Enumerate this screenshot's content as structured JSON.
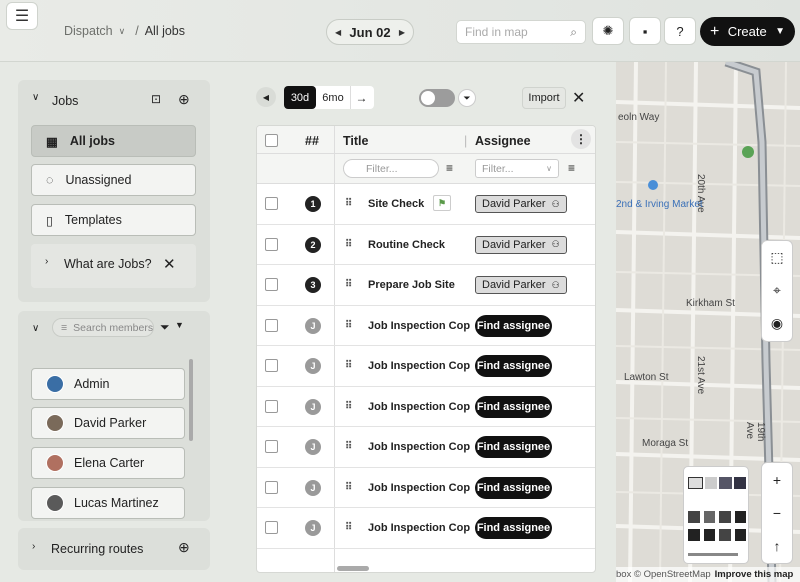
{
  "topbar": {
    "breadcrumb_parent": "Dispatch",
    "breadcrumb_current": "All jobs",
    "date": "Jun 02",
    "map_search_placeholder": "Find in map",
    "help_label": "?",
    "create_label": "Create"
  },
  "toolbar": {
    "range_30d": "30d",
    "range_6mo": "6mo",
    "import_label": "Import"
  },
  "sidebar": {
    "jobs_title": "Jobs",
    "items": [
      {
        "label": "All jobs",
        "icon": "table-icon",
        "active": true
      },
      {
        "label": "Unassigned",
        "icon": "speech-bubble-icon",
        "active": false
      },
      {
        "label": "Templates",
        "icon": "bookmark-icon",
        "active": false
      }
    ],
    "what_are_jobs": "What are Jobs?",
    "member_search_placeholder": "Search members",
    "members": [
      {
        "name": "Admin",
        "avatar_color": "#3a6ea5"
      },
      {
        "name": "David Parker",
        "avatar_color": "#7a6a5a"
      },
      {
        "name": "Elena Carter",
        "avatar_color": "#b07060"
      },
      {
        "name": "Lucas Martinez",
        "avatar_color": "#5a5a5a"
      }
    ],
    "recurring_routes": "Recurring routes"
  },
  "table": {
    "col_num": "##",
    "col_title": "Title",
    "col_assignee": "Assignee",
    "filter_placeholder": "Filter...",
    "find_assignee_label": "Find assignee",
    "rows": [
      {
        "num": "1",
        "title": "Site Check",
        "assignee": "David Parker",
        "flag": true
      },
      {
        "num": "2",
        "title": "Routine Check",
        "assignee": "David Parker",
        "flag": false
      },
      {
        "num": "3",
        "title": "Prepare Job Site",
        "assignee": "David Parker",
        "flag": false
      },
      {
        "num": "J",
        "title": "Job Inspection Cop",
        "assignee": "",
        "flag": false
      },
      {
        "num": "J",
        "title": "Job Inspection Cop",
        "assignee": "",
        "flag": false
      },
      {
        "num": "J",
        "title": "Job Inspection Cop",
        "assignee": "",
        "flag": false
      },
      {
        "num": "J",
        "title": "Job Inspection Cop",
        "assignee": "",
        "flag": false
      },
      {
        "num": "J",
        "title": "Job Inspection Cop",
        "assignee": "",
        "flag": false
      },
      {
        "num": "J",
        "title": "Job Inspection Cop",
        "assignee": "",
        "flag": false
      }
    ]
  },
  "map": {
    "labels": {
      "l1": "eoln Way",
      "l2": "20th Ave",
      "l3": "2nd & Irving Market",
      "l4": "Kirkham St",
      "l5": "21st Ave",
      "l6": "Lawton St",
      "l7": "Moraga St",
      "l8": "19th Ave"
    },
    "attribution": "box © OpenStreetMap",
    "improve": "Improve this map",
    "zoom_in": "+",
    "zoom_out": "−",
    "north": "↑"
  }
}
